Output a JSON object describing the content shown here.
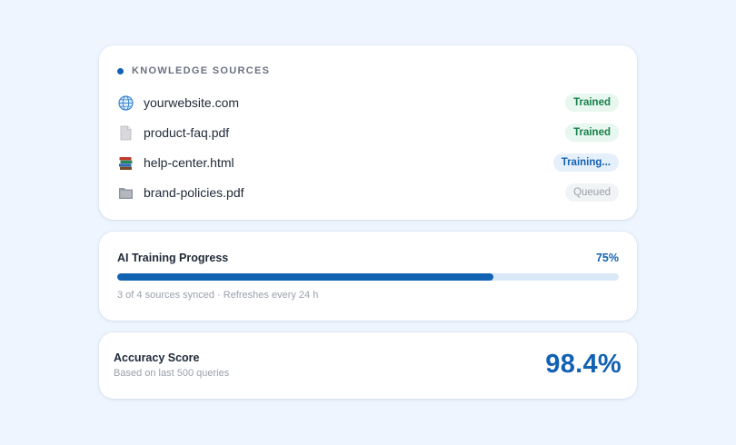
{
  "sources": {
    "title": "KNOWLEDGE SOURCES",
    "items": [
      {
        "name": "yourwebsite.com",
        "icon": "globe-icon",
        "status": "Trained"
      },
      {
        "name": "product-faq.pdf",
        "icon": "document-icon",
        "status": "Trained"
      },
      {
        "name": "help-center.html",
        "icon": "books-icon",
        "status": "Training..."
      },
      {
        "name": "brand-policies.pdf",
        "icon": "folder-icon",
        "status": "Queued"
      }
    ]
  },
  "progress": {
    "title": "AI Training Progress",
    "percent_label": "75%",
    "fraction": 0.75,
    "note": "3 of 4 sources synced · Refreshes every 24 h"
  },
  "accuracy": {
    "title": "Accuracy Score",
    "subtitle": "Based on last 500 queries",
    "score": "98.4%"
  },
  "colors": {
    "accent": "#1262b3",
    "trained_bg": "#e8f7ef",
    "trained_text": "#15804a",
    "training_bg": "#e6f0fb",
    "queued_bg": "#f2f3f5",
    "page_bg": "#eef5fe"
  }
}
